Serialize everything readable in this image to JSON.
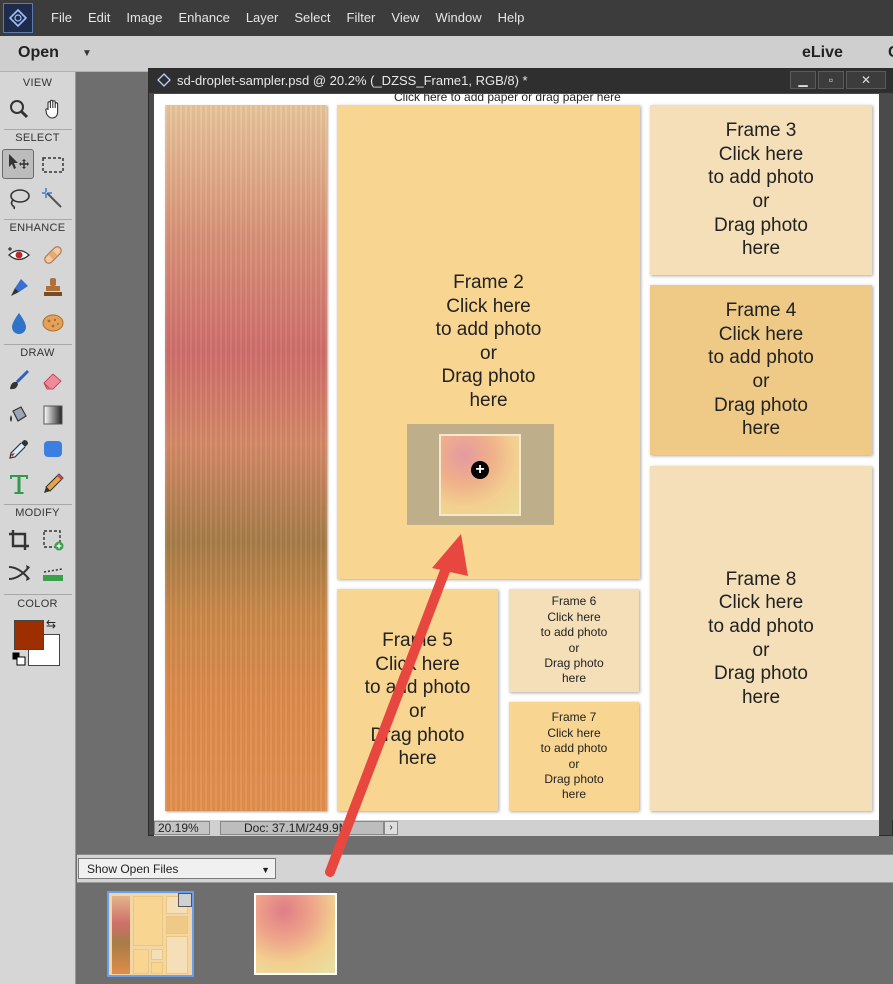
{
  "menubar": {
    "items": [
      "File",
      "Edit",
      "Image",
      "Enhance",
      "Layer",
      "Select",
      "Filter",
      "View",
      "Window",
      "Help"
    ]
  },
  "header": {
    "open_label": "Open",
    "elive_label": "eLive",
    "cut_label": "C"
  },
  "tools": {
    "sections": {
      "view": "VIEW",
      "select": "SELECT",
      "enhance": "ENHANCE",
      "draw": "DRAW",
      "modify": "MODIFY",
      "color": "COLOR"
    },
    "icons": [
      "zoom-icon",
      "hand-icon",
      "move-icon",
      "marquee-icon",
      "lasso-icon",
      "magic-wand-icon",
      "red-eye-icon",
      "spot-healing-icon",
      "smart-brush-icon",
      "clone-stamp-icon",
      "blur-icon",
      "sponge-icon",
      "brush-icon",
      "eraser-icon",
      "paint-bucket-icon",
      "gradient-icon",
      "eyedropper-icon",
      "shape-icon",
      "type-icon",
      "pencil-icon",
      "crop-icon",
      "recompose-icon",
      "content-aware-move-icon",
      "straighten-icon"
    ],
    "foreground_color": "#9c2e00",
    "background_color": "#ffffff"
  },
  "document": {
    "title": "sd-droplet-sampler.psd @ 20.2% (_DZSS_Frame1, RGB/8) *",
    "canvas_hint": "Click here to add paper or drag paper here",
    "zoom": "20.19%",
    "doc_info": "Doc: 37.1M/249.9M",
    "window_controls": [
      "minimize-icon",
      "restore-icon",
      "close-icon"
    ]
  },
  "frames": {
    "frame2": [
      "Frame 2",
      "Click here",
      "to add photo",
      "or",
      "Drag photo",
      "here"
    ],
    "frame3": [
      "Frame 3",
      "Click here",
      "to add photo",
      "or",
      "Drag photo",
      "here"
    ],
    "frame4": [
      "Frame 4",
      "Click here",
      "to add photo",
      "or",
      "Drag photo",
      "here"
    ],
    "frame5": [
      "Frame 5",
      "Click here",
      "to add photo",
      "or",
      "Drag photo",
      "here"
    ],
    "frame6": [
      "Frame 6",
      "Click here",
      "to add photo",
      "or",
      "Drag photo",
      "here"
    ],
    "frame7": [
      "Frame 7",
      "Click here",
      "to add photo",
      "or",
      "Drag photo",
      "here"
    ],
    "frame8": [
      "Frame 8",
      "Click here",
      "to add photo",
      "or",
      "Drag photo",
      "here"
    ]
  },
  "photobin": {
    "dropdown_value": "Show Open Files"
  },
  "annotation": {
    "arrow_color": "#e8473f"
  }
}
